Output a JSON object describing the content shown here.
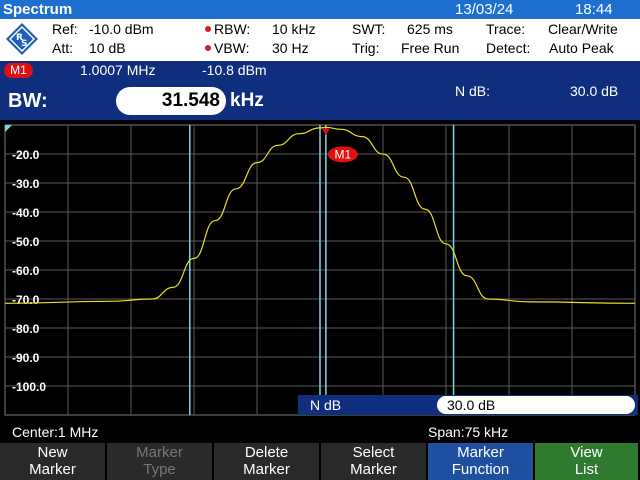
{
  "title_bar": {
    "title": "Spectrum",
    "date": "13/03/24",
    "time": "18:44"
  },
  "settings": {
    "ref_label": "Ref:",
    "ref_value": "-10.0 dBm",
    "att_label": "Att:",
    "att_value": "10 dB",
    "rbw_label": "RBW:",
    "rbw_value": "10 kHz",
    "vbw_label": "VBW:",
    "vbw_value": "30 Hz",
    "swt_label": "SWT:",
    "swt_value": "625 ms",
    "trig_label": "Trig:",
    "trig_value": "Free Run",
    "trace_label": "Trace:",
    "trace_value": "Clear/Write",
    "detect_label": "Detect:",
    "detect_value": "Auto Peak"
  },
  "marker": {
    "badge": "M1",
    "frequency": "1.0007  MHz",
    "level": "-10.8   dBm"
  },
  "bw_readout": {
    "label": "BW:",
    "value": "31.548",
    "unit": "kHz",
    "ndb_label": "N dB:",
    "ndb_value": "30.0 dB"
  },
  "chart_data": {
    "type": "line",
    "y_tick_labels": [
      "-20.0",
      "-30.0",
      "-40.0",
      "-50.0",
      "-60.0",
      "-70.0",
      "-80.0",
      "-90.0",
      "-100.0"
    ],
    "ylim": [
      -110,
      -10
    ],
    "xlim": [
      0.9625,
      1.0375
    ],
    "grid": true,
    "x": [
      0.9625,
      0.975,
      0.98,
      0.9825,
      0.985,
      0.9875,
      0.99,
      0.9925,
      0.995,
      0.9975,
      1.0,
      1.0007,
      1.0025,
      1.005,
      1.0075,
      1.01,
      1.0125,
      1.015,
      1.0175,
      1.02,
      1.025,
      1.0375
    ],
    "y": [
      -71.5,
      -70.8,
      -70.0,
      -66,
      -56,
      -43,
      -32,
      -23,
      -17,
      -13,
      -11,
      -10.8,
      -11.5,
      -14,
      -20,
      -28,
      -39,
      -51,
      -62,
      -70.0,
      -71.0,
      -71.5
    ],
    "marker_m1": {
      "x": 1.0007,
      "y": -10.8,
      "label": "M1"
    },
    "vertical_lines": [
      0.9845,
      1.0,
      1.0007,
      1.0159
    ],
    "trace_color": "#e8e020",
    "line_color": "#7fd4e6"
  },
  "ndb_box": {
    "label": "N dB",
    "value": "30.0 dB"
  },
  "status": {
    "center": "Center:1 MHz",
    "span": "Span:75 kHz"
  },
  "softkeys": [
    {
      "line1": "New",
      "line2": "Marker"
    },
    {
      "line1": "Marker",
      "line2": "Type"
    },
    {
      "line1": "Delete",
      "line2": "Marker"
    },
    {
      "line1": "Select",
      "line2": "Marker"
    },
    {
      "line1": "Marker",
      "line2": "Function"
    },
    {
      "line1": "View",
      "line2": "List"
    }
  ],
  "colors": {
    "title_bar": "#1d6fd0",
    "panel": "#0f2f7e",
    "trace": "#e8e020",
    "marker": "#dd1111"
  }
}
